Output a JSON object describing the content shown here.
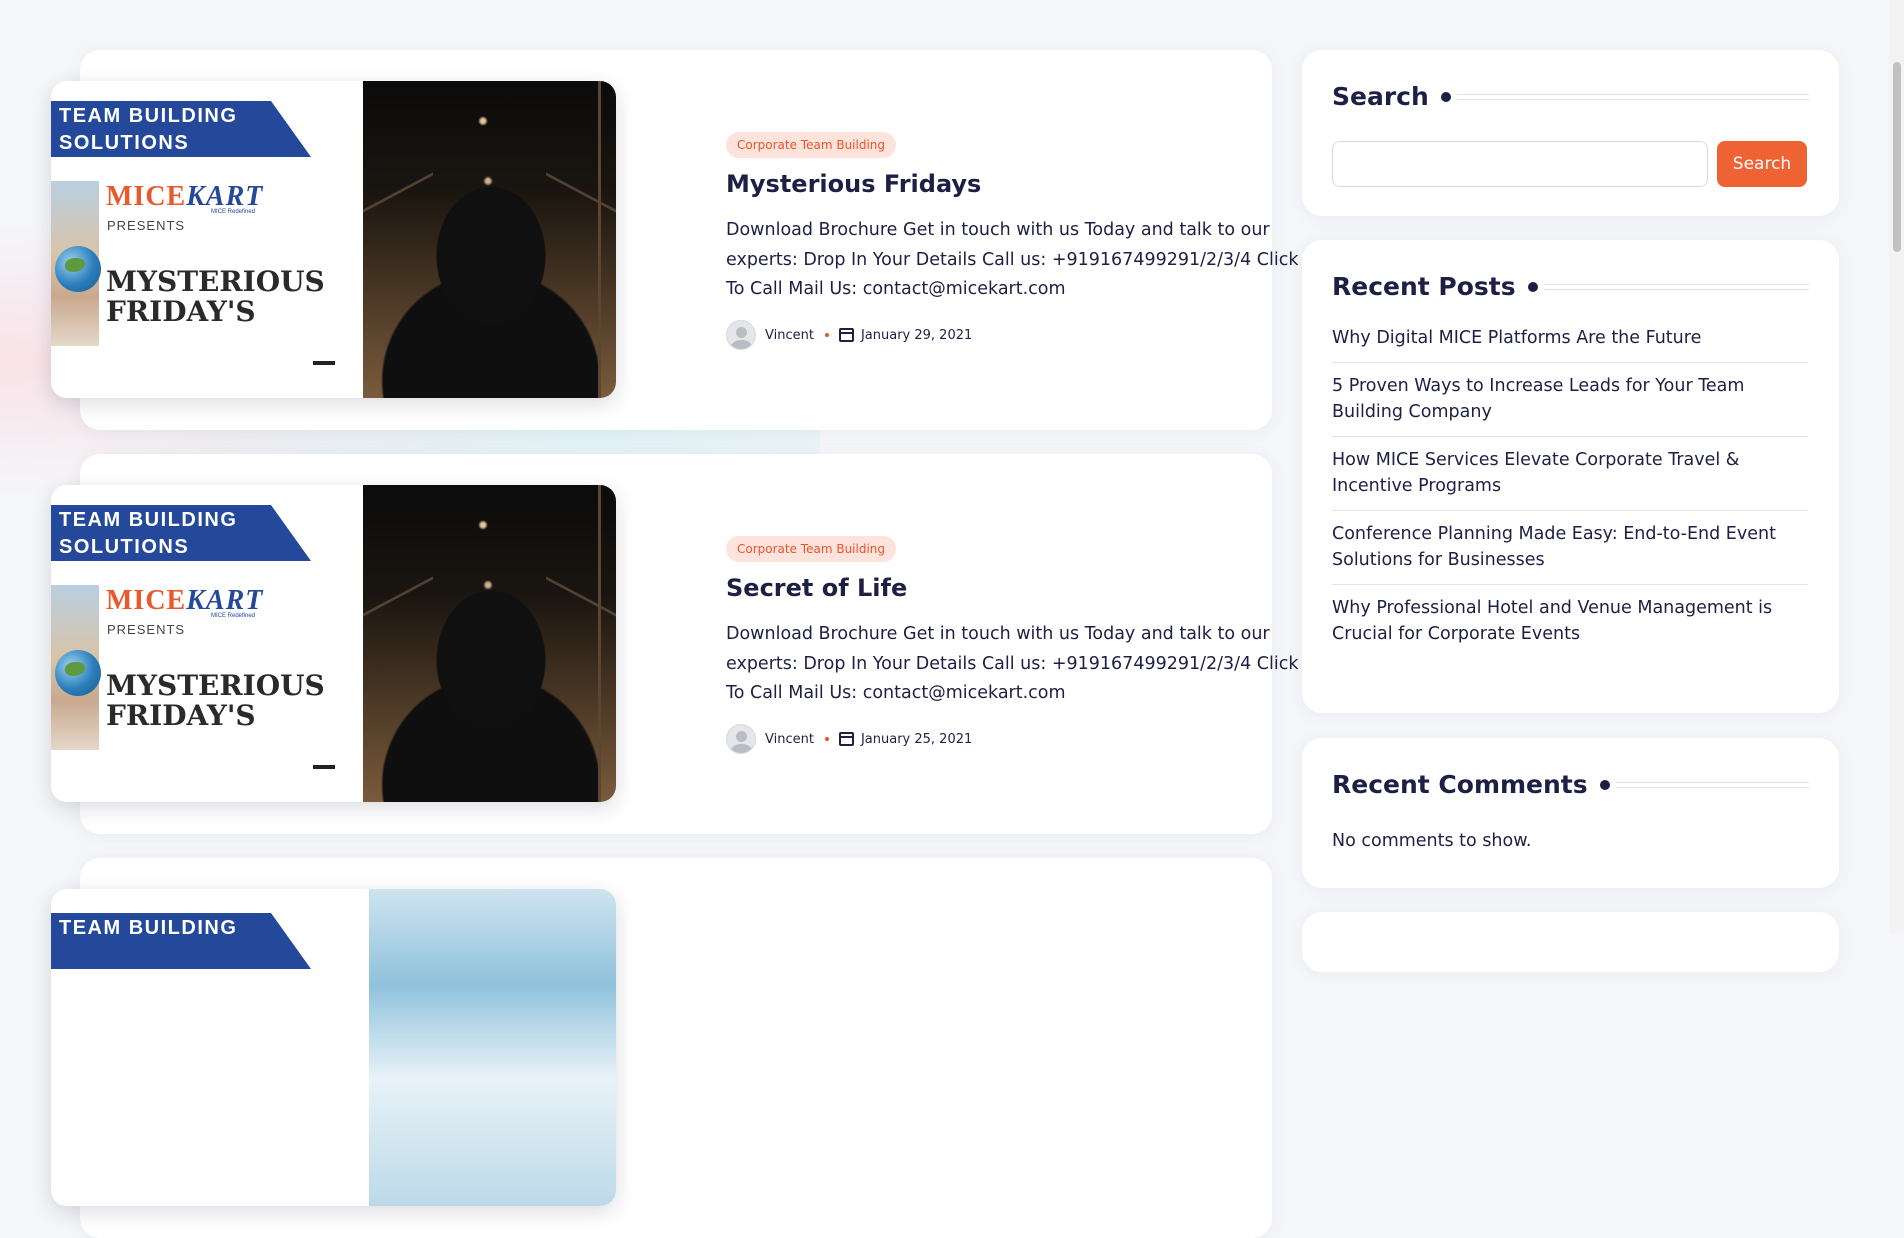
{
  "posts": [
    {
      "banner": "TEAM BUILDING SOLUTIONS",
      "logo": "MICE",
      "logo_k": "KART",
      "logo_tagline": "MICE Redefined",
      "presents": "PRESENTS",
      "headline": "MYSTERIOUS FRIDAY'S",
      "category": "Corporate Team Building",
      "title": "Mysterious Fridays",
      "excerpt": "Download Brochure Get in touch with us Today and talk to our experts: Drop In Your Details   Call us: +919167499291/2/3/4 Click To Call Mail Us: contact@micekart.com",
      "author": "Vincent",
      "date": "January 29, 2021"
    },
    {
      "banner": "TEAM BUILDING SOLUTIONS",
      "logo": "MICE",
      "logo_k": "KART",
      "logo_tagline": "MICE Redefined",
      "presents": "PRESENTS",
      "headline": "MYSTERIOUS FRIDAY'S",
      "category": "Corporate Team Building",
      "title": "Secret of Life",
      "excerpt": "Download Brochure Get in touch with us Today and talk to our experts: Drop In Your Details   Call us: +919167499291/2/3/4 Click To Call Mail Us: contact@micekart.com",
      "author": "Vincent",
      "date": "January 25, 2021"
    },
    {
      "banner": "TEAM BUILDING"
    }
  ],
  "sidebar": {
    "search": {
      "title": "Search",
      "button": "Search",
      "value": ""
    },
    "recent_posts": {
      "title": "Recent Posts",
      "items": [
        "Why Digital MICE Platforms Are the Future",
        "5 Proven Ways to Increase Leads for Your Team Building Company",
        "How MICE Services Elevate Corporate Travel & Incentive Programs",
        "Conference Planning Made Easy: End-to-End Event Solutions for Businesses",
        "Why Professional Hotel and Venue Management is Crucial for Corporate Events"
      ]
    },
    "recent_comments": {
      "title": "Recent Comments",
      "empty": "No comments to show."
    }
  },
  "colors": {
    "accent": "#ef6234",
    "text": "#1d1f45",
    "badge_bg": "#fde3dc",
    "brand_blue": "#24489a"
  }
}
